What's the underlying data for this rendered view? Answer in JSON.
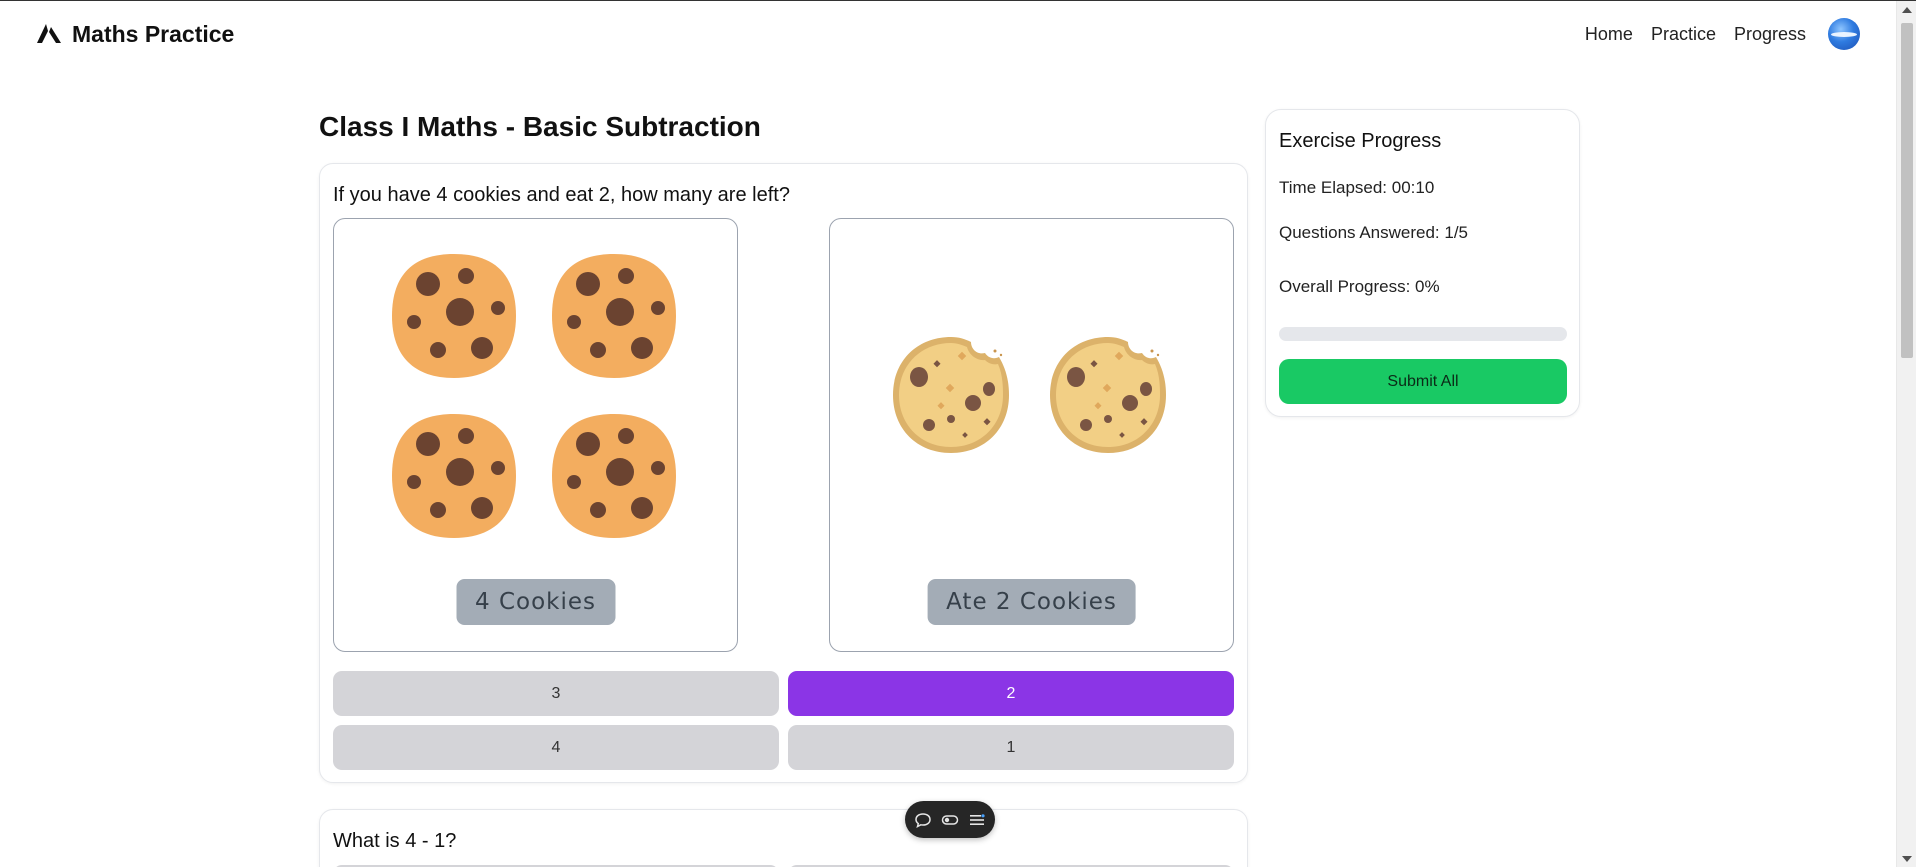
{
  "app": {
    "brand_name": "Maths Practice",
    "logo_icon": "triangle-logo-icon"
  },
  "nav": {
    "links": [
      {
        "label": "Home"
      },
      {
        "label": "Practice"
      },
      {
        "label": "Progress"
      }
    ],
    "avatar_icon": "globe-avatar-icon"
  },
  "main": {
    "title": "Class I Maths - Basic Subtraction",
    "questions": [
      {
        "text": "If you have 4 cookies and eat 2, how many are left?",
        "panels": [
          {
            "label": "4 Cookies",
            "icon": "cookie-icon",
            "count": 4
          },
          {
            "label": "Ate 2 Cookies",
            "icon": "bitten-cookie-icon",
            "count": 2
          }
        ],
        "options": [
          "3",
          "2",
          "4",
          "1"
        ],
        "selected": "2"
      },
      {
        "text": "What is 4 - 1?"
      }
    ]
  },
  "progress": {
    "title": "Exercise Progress",
    "time_elapsed": "Time Elapsed: 00:10",
    "questions_answered": "Questions Answered: 1/5",
    "overall_progress": "Overall Progress: 0%",
    "progress_fraction": 0,
    "submit_label": "Submit All"
  },
  "toolbar": {
    "icons": [
      "chat-icon",
      "toggle-icon",
      "menu-icon"
    ]
  },
  "colors": {
    "selected_option": "#8b35e6",
    "submit": "#19c964",
    "option_default": "#d4d4d8"
  }
}
